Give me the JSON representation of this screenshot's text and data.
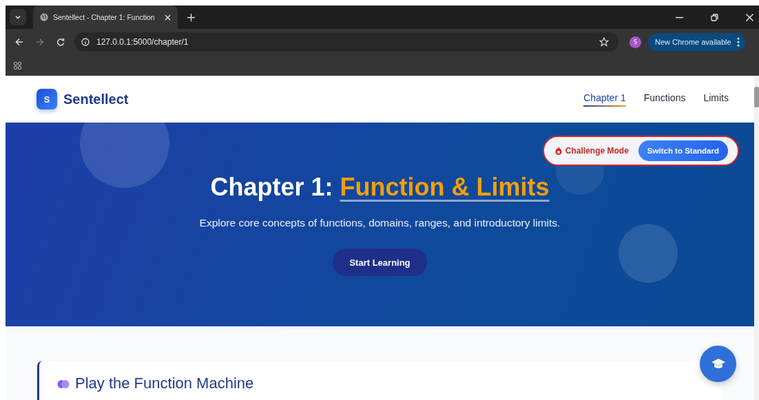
{
  "browser": {
    "tabs": [
      {
        "title": "Sentellect - Chapter 1: Function",
        "selected": true
      }
    ],
    "address": "127.0.0.1:5000/chapter/1",
    "profile_initial": "S",
    "update_button": "New Chrome available"
  },
  "site": {
    "logo_letter": "S",
    "brand": "Sentellect",
    "nav": [
      {
        "label": "Chapter 1",
        "selected": true
      },
      {
        "label": "Functions",
        "selected": false
      },
      {
        "label": "Limits",
        "selected": false
      }
    ]
  },
  "mode": {
    "label": "Challenge Mode",
    "switch_button": "Switch to Standard"
  },
  "hero": {
    "title_prefix": "Chapter 1: ",
    "title_highlight": "Function & Limits",
    "subtitle": "Explore core concepts of functions, domains, ranges, and introductory limits.",
    "cta": "Start Learning"
  },
  "section": {
    "title": "Play the Function Machine"
  }
}
